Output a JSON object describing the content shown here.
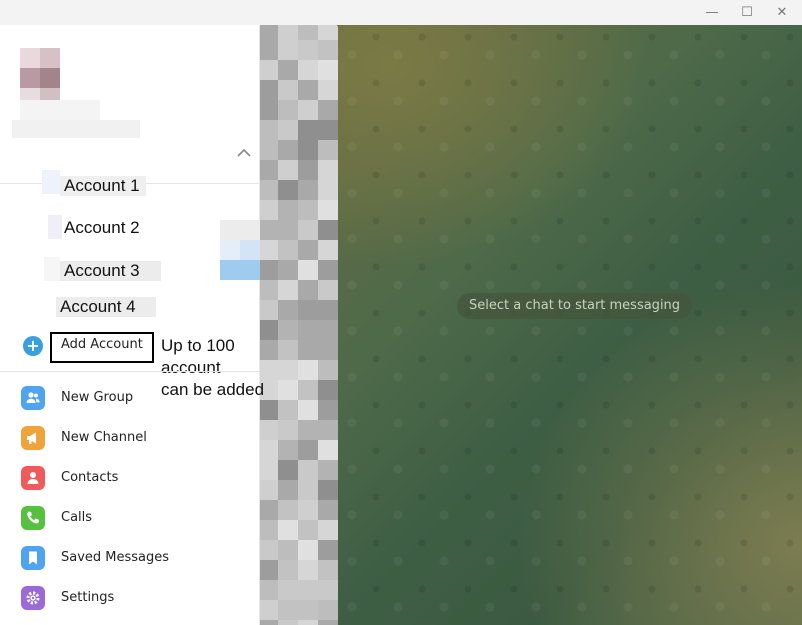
{
  "window": {
    "controls": [
      {
        "name": "minimize-button",
        "glyph": "—"
      },
      {
        "name": "maximize-button",
        "glyph": "☐"
      },
      {
        "name": "close-button",
        "glyph": "✕"
      }
    ]
  },
  "accounts": [
    {
      "label": "Account 1"
    },
    {
      "label": "Account 2"
    },
    {
      "label": "Account 3"
    },
    {
      "label": "Account 4"
    }
  ],
  "add_account": {
    "label": "Add Account",
    "icon": "plus-circle-icon"
  },
  "annotation": {
    "lines": [
      "Up to 100",
      "account",
      "can be added"
    ]
  },
  "menu": {
    "items": [
      {
        "label": "New Group",
        "icon": "group-icon",
        "color": "#4ea4f0"
      },
      {
        "label": "New Channel",
        "icon": "megaphone-icon",
        "color": "#f0a33a"
      },
      {
        "label": "Contacts",
        "icon": "person-icon",
        "color": "#ef5a5a"
      },
      {
        "label": "Calls",
        "icon": "phone-icon",
        "color": "#55c13f"
      },
      {
        "label": "Saved Messages",
        "icon": "bookmark-icon",
        "color": "#4ea4f0"
      },
      {
        "label": "Settings",
        "icon": "gear-icon",
        "color": "#9a6bd8"
      }
    ]
  },
  "chat": {
    "hint": "Select a chat to start messaging"
  }
}
